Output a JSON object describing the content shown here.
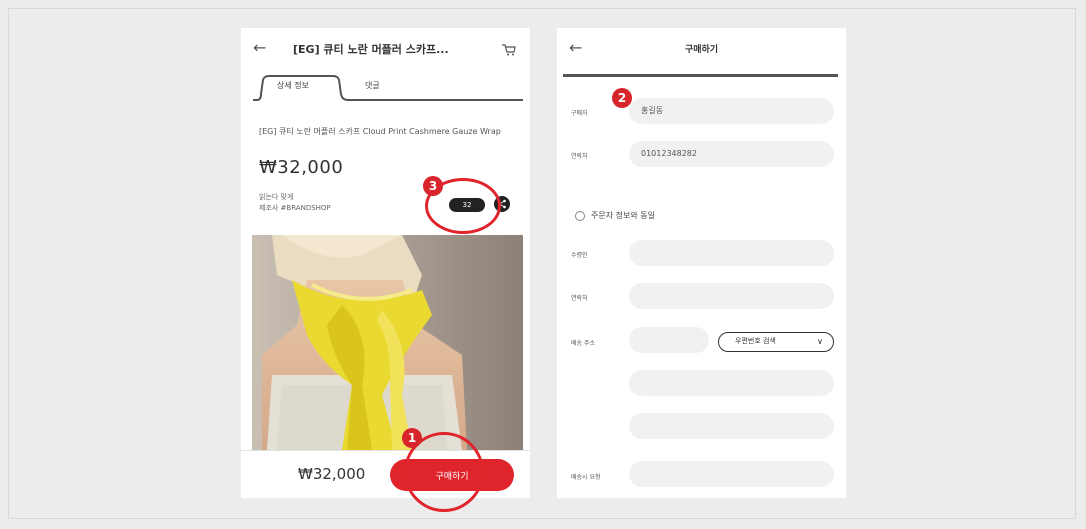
{
  "left_screen": {
    "back_icon": "←",
    "title": "[EG] 큐티 노란 머플러 스카프...",
    "cart_icon": "cart-icon",
    "tabs": [
      "상세 정보",
      "댓글"
    ],
    "product_name": "[EG] 큐티 노란 머플러 스카프 Cloud Print Cashmere Gauze Wrap",
    "price": "₩32,000",
    "meta_line1": "읽는다 맞게",
    "meta_line2": "제조사 #BRANDSHOP",
    "pill_label": "32",
    "share_icon": "share-icon",
    "bottom_price": "₩32,000",
    "buy_button": "구매하기"
  },
  "right_screen": {
    "back_icon": "←",
    "title": "구매하기",
    "fields": [
      {
        "label": "구매자",
        "value": "홍길동"
      },
      {
        "label": "연락처",
        "value": "01012348282"
      }
    ],
    "section_title": "주문자 정보와 동일",
    "delivery_fields": [
      {
        "label": "수령인",
        "value": ""
      },
      {
        "label": "연락처",
        "value": ""
      },
      {
        "label": "배송 주소",
        "value": ""
      },
      {
        "label": "",
        "value": ""
      },
      {
        "label": "",
        "value": ""
      },
      {
        "label": "배송시 요청",
        "value": ""
      }
    ],
    "zip_button": "우편번호 검색",
    "zip_chevron": "∨"
  },
  "annotations": [
    "1",
    "2",
    "3"
  ],
  "colors": {
    "accent": "#e0242b",
    "background": "#ececec"
  }
}
